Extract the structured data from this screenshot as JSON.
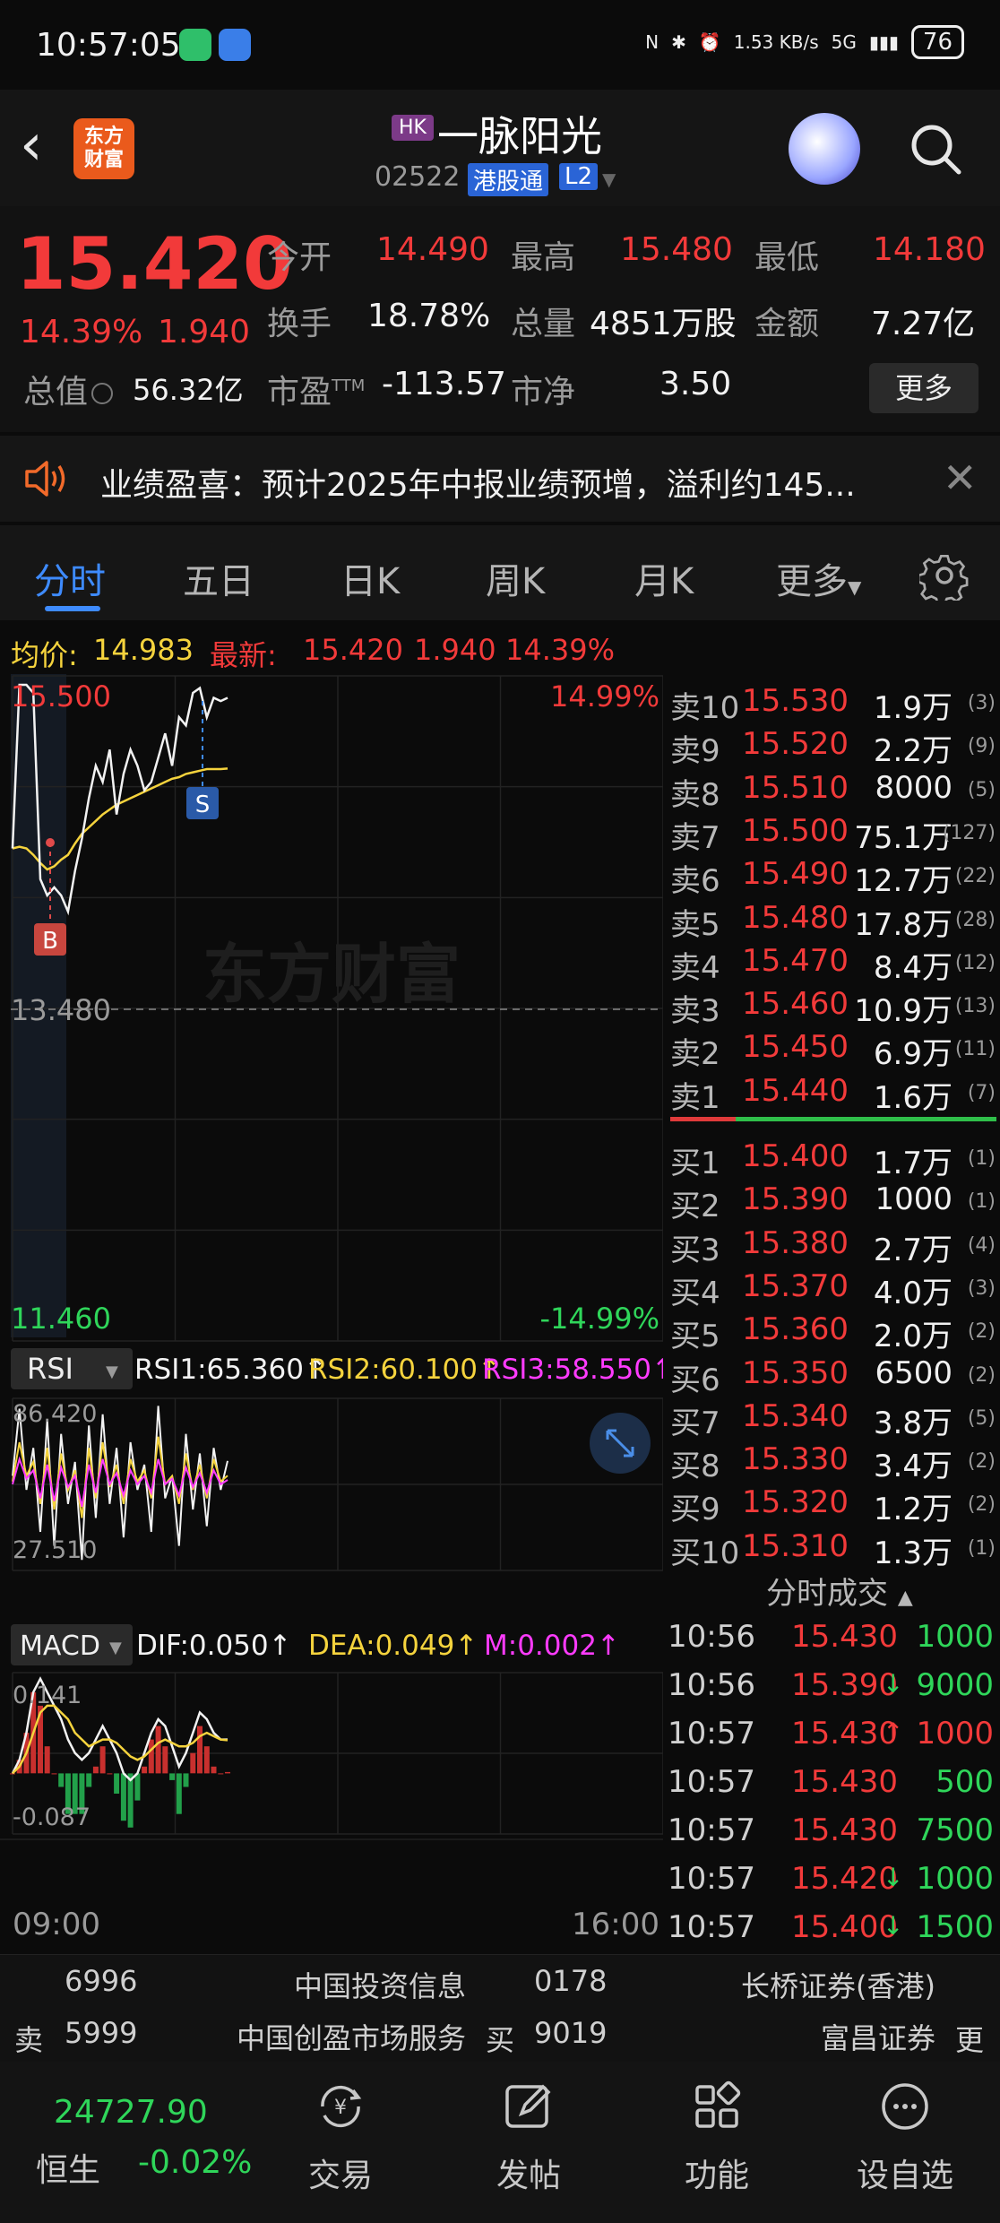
{
  "status_bar": {
    "time": "10:57:05",
    "net_speed": "1.53 KB/s",
    "network": "5G",
    "battery": "76"
  },
  "header": {
    "market_badge": "HK",
    "stock_name": "一脉阳光",
    "stock_code": "02522",
    "connect_badge": "港股通",
    "level_badge": "L2",
    "logo_text_top": "东方",
    "logo_text_bottom": "财富"
  },
  "quote": {
    "price": "15.420",
    "change_pct": "14.39%",
    "change_amt": "1.940",
    "open_label": "今开",
    "open": "14.490",
    "high_label": "最高",
    "high": "15.480",
    "low_label": "最低",
    "low": "14.180",
    "turnover_label": "换手",
    "turnover": "18.78%",
    "volume_label": "总量",
    "volume": "4851万股",
    "amount_label": "金额",
    "amount": "7.27亿",
    "mcap_label": "总值",
    "mcap": "56.32亿",
    "pe_label": "市盈",
    "pe_sup": "TTM",
    "pe": "-113.57",
    "pb_label": "市净",
    "pb": "3.50",
    "more_label": "更多"
  },
  "notice": {
    "text": "业绩盈喜：预计2025年中报业绩预增，溢利约145..."
  },
  "tabs": [
    {
      "label": "分时"
    },
    {
      "label": "五日"
    },
    {
      "label": "日K"
    },
    {
      "label": "周K"
    },
    {
      "label": "月K"
    },
    {
      "label": "更多"
    }
  ],
  "info_line": {
    "avg_label": "均价:",
    "avg": "14.983",
    "latest_label": "最新:",
    "latest": "15.420",
    "latest_chg": "1.940",
    "latest_pct": "14.39%"
  },
  "chart_labels": {
    "top_price": "15.500",
    "top_pct": "14.99%",
    "mid_price": "13.480",
    "bottom_price": "11.460",
    "bottom_pct": "-14.99%",
    "watermark": "东方财富",
    "buy_marker": "B",
    "sell_marker": "S",
    "rsi_select": "RSI",
    "rsi1": "RSI1:65.360",
    "rsi2": "RSI2:60.100",
    "rsi3": "RSI3:58.550",
    "rsi_top": "86.420",
    "rsi_bottom": "27.510",
    "macd_select": "MACD",
    "dif": "DIF:0.050",
    "dea": "DEA:0.049",
    "m": "M:0.002",
    "macd_top": "0.141",
    "macd_bottom": "-0.087",
    "time_start": "09:00",
    "time_end": "16:00",
    "arrow_up": "↑"
  },
  "sell_orders": [
    {
      "label": "卖10",
      "price": "15.530",
      "vol": "1.9万",
      "count": "(3)"
    },
    {
      "label": "卖9",
      "price": "15.520",
      "vol": "2.2万",
      "count": "(9)"
    },
    {
      "label": "卖8",
      "price": "15.510",
      "vol": "8000",
      "count": "(5)"
    },
    {
      "label": "卖7",
      "price": "15.500",
      "vol": "75.1万",
      "count": "(127)"
    },
    {
      "label": "卖6",
      "price": "15.490",
      "vol": "12.7万",
      "count": "(22)"
    },
    {
      "label": "卖5",
      "price": "15.480",
      "vol": "17.8万",
      "count": "(28)"
    },
    {
      "label": "卖4",
      "price": "15.470",
      "vol": "8.4万",
      "count": "(12)"
    },
    {
      "label": "卖3",
      "price": "15.460",
      "vol": "10.9万",
      "count": "(13)"
    },
    {
      "label": "卖2",
      "price": "15.450",
      "vol": "6.9万",
      "count": "(11)"
    },
    {
      "label": "卖1",
      "price": "15.440",
      "vol": "1.6万",
      "count": "(7)"
    }
  ],
  "buy_orders": [
    {
      "label": "买1",
      "price": "15.400",
      "vol": "1.7万",
      "count": "(1)"
    },
    {
      "label": "买2",
      "price": "15.390",
      "vol": "1000",
      "count": "(1)"
    },
    {
      "label": "买3",
      "price": "15.380",
      "vol": "2.7万",
      "count": "(4)"
    },
    {
      "label": "买4",
      "price": "15.370",
      "vol": "4.0万",
      "count": "(3)"
    },
    {
      "label": "买5",
      "price": "15.360",
      "vol": "2.0万",
      "count": "(2)"
    },
    {
      "label": "买6",
      "price": "15.350",
      "vol": "6500",
      "count": "(2)"
    },
    {
      "label": "买7",
      "price": "15.340",
      "vol": "3.8万",
      "count": "(5)"
    },
    {
      "label": "买8",
      "price": "15.330",
      "vol": "3.4万",
      "count": "(2)"
    },
    {
      "label": "买9",
      "price": "15.320",
      "vol": "1.2万",
      "count": "(2)"
    },
    {
      "label": "买10",
      "price": "15.310",
      "vol": "1.3万",
      "count": "(1)"
    }
  ],
  "ticks_title": "分时成交",
  "ticks": [
    {
      "time": "10:56",
      "price": "15.430",
      "dir": "",
      "vol": "1000",
      "vol_color": "green"
    },
    {
      "time": "10:56",
      "price": "15.390",
      "dir": "↓",
      "vol": "9000",
      "vol_color": "green"
    },
    {
      "time": "10:57",
      "price": "15.430",
      "dir": "↑",
      "vol": "1000",
      "vol_color": "red"
    },
    {
      "time": "10:57",
      "price": "15.430",
      "dir": "",
      "vol": "500",
      "vol_color": "green"
    },
    {
      "time": "10:57",
      "price": "15.430",
      "dir": "",
      "vol": "7500",
      "vol_color": "green"
    },
    {
      "time": "10:57",
      "price": "15.420",
      "dir": "↓",
      "vol": "1000",
      "vol_color": "green"
    },
    {
      "time": "10:57",
      "price": "15.400",
      "dir": "↓",
      "vol": "1500",
      "vol_color": "green"
    }
  ],
  "brokers": {
    "sell_label": "卖",
    "buy_label": "买",
    "more_label": "更",
    "sell": [
      {
        "code": "6996",
        "name": "中国投资信息"
      },
      {
        "code": "5999",
        "name": "中国创盈市场服务"
      }
    ],
    "buy": [
      {
        "code": "0178",
        "name": "长桥证券(香港)"
      },
      {
        "code": "9019",
        "name": "富昌证券"
      }
    ]
  },
  "bottom_nav": {
    "index_value": "24727.90",
    "index_name": "恒生",
    "index_pct": "-0.02%",
    "items": [
      {
        "label": "交易"
      },
      {
        "label": "发帖"
      },
      {
        "label": "功能"
      },
      {
        "label": "设自选"
      }
    ]
  },
  "chart_data": {
    "type": "line",
    "title": "",
    "price_range": [
      11.46,
      15.5
    ],
    "prev_close": 13.48,
    "price_series": [
      14.49,
      15.5,
      15.5,
      15.45,
      14.3,
      14.2,
      14.25,
      14.2,
      14.1,
      14.35,
      14.55,
      14.8,
      15.0,
      14.9,
      15.1,
      14.7,
      14.95,
      15.1,
      15.0,
      14.85,
      14.9,
      15.05,
      15.2,
      15.0,
      15.3,
      15.25,
      15.45,
      15.48,
      15.3,
      15.42,
      15.4,
      15.42
    ],
    "avg_series": [
      14.49,
      14.5,
      14.49,
      14.45,
      14.4,
      14.36,
      14.38,
      14.42,
      14.45,
      14.52,
      14.58,
      14.62,
      14.66,
      14.7,
      14.73,
      14.76,
      14.78,
      14.8,
      14.82,
      14.84,
      14.86,
      14.88,
      14.9,
      14.92,
      14.93,
      14.95,
      14.96,
      14.97,
      14.98,
      14.98,
      14.98,
      14.983
    ],
    "rsi_range": [
      27.51,
      86.42
    ],
    "rsi1": [
      60,
      84,
      55,
      70,
      40,
      80,
      35,
      75,
      50,
      65,
      30,
      78,
      45,
      82,
      50,
      70,
      38,
      72,
      55,
      64,
      40,
      85,
      52,
      60,
      35,
      75,
      48,
      68,
      42,
      70,
      55,
      65.36
    ],
    "rsi2": [
      58,
      72,
      60,
      65,
      50,
      70,
      48,
      68,
      55,
      62,
      45,
      70,
      52,
      72,
      56,
      64,
      50,
      66,
      58,
      62,
      52,
      74,
      57,
      60,
      50,
      68,
      55,
      64,
      52,
      66,
      58,
      60.1
    ],
    "rsi3": [
      57,
      66,
      59,
      62,
      52,
      64,
      51,
      63,
      56,
      60,
      49,
      64,
      54,
      66,
      57,
      61,
      53,
      62,
      57,
      60,
      54,
      66,
      57,
      59,
      53,
      63,
      56,
      61,
      54,
      62,
      57,
      58.55
    ],
    "macd_range": [
      -0.087,
      0.141
    ],
    "dif": [
      0.0,
      0.02,
      0.06,
      0.12,
      0.14,
      0.12,
      0.1,
      0.08,
      0.05,
      0.03,
      0.02,
      0.03,
      0.05,
      0.07,
      0.05,
      0.03,
      0.0,
      -0.01,
      0.0,
      0.03,
      0.06,
      0.08,
      0.07,
      0.04,
      0.01,
      0.03,
      0.06,
      0.09,
      0.08,
      0.06,
      0.05,
      0.05
    ],
    "dea": [
      0.0,
      0.01,
      0.03,
      0.06,
      0.09,
      0.1,
      0.1,
      0.09,
      0.08,
      0.06,
      0.05,
      0.04,
      0.045,
      0.05,
      0.05,
      0.045,
      0.035,
      0.025,
      0.02,
      0.025,
      0.035,
      0.045,
      0.05,
      0.045,
      0.04,
      0.04,
      0.045,
      0.055,
      0.06,
      0.055,
      0.05,
      0.049
    ],
    "macd_hist": [
      0.0,
      0.02,
      0.06,
      0.12,
      0.1,
      0.04,
      0.0,
      -0.02,
      -0.06,
      -0.06,
      -0.06,
      -0.02,
      0.01,
      0.04,
      0.0,
      -0.03,
      -0.07,
      -0.08,
      -0.04,
      0.01,
      0.05,
      0.07,
      0.04,
      -0.01,
      -0.06,
      -0.02,
      0.03,
      0.07,
      0.04,
      0.01,
      0.0,
      0.002
    ]
  }
}
